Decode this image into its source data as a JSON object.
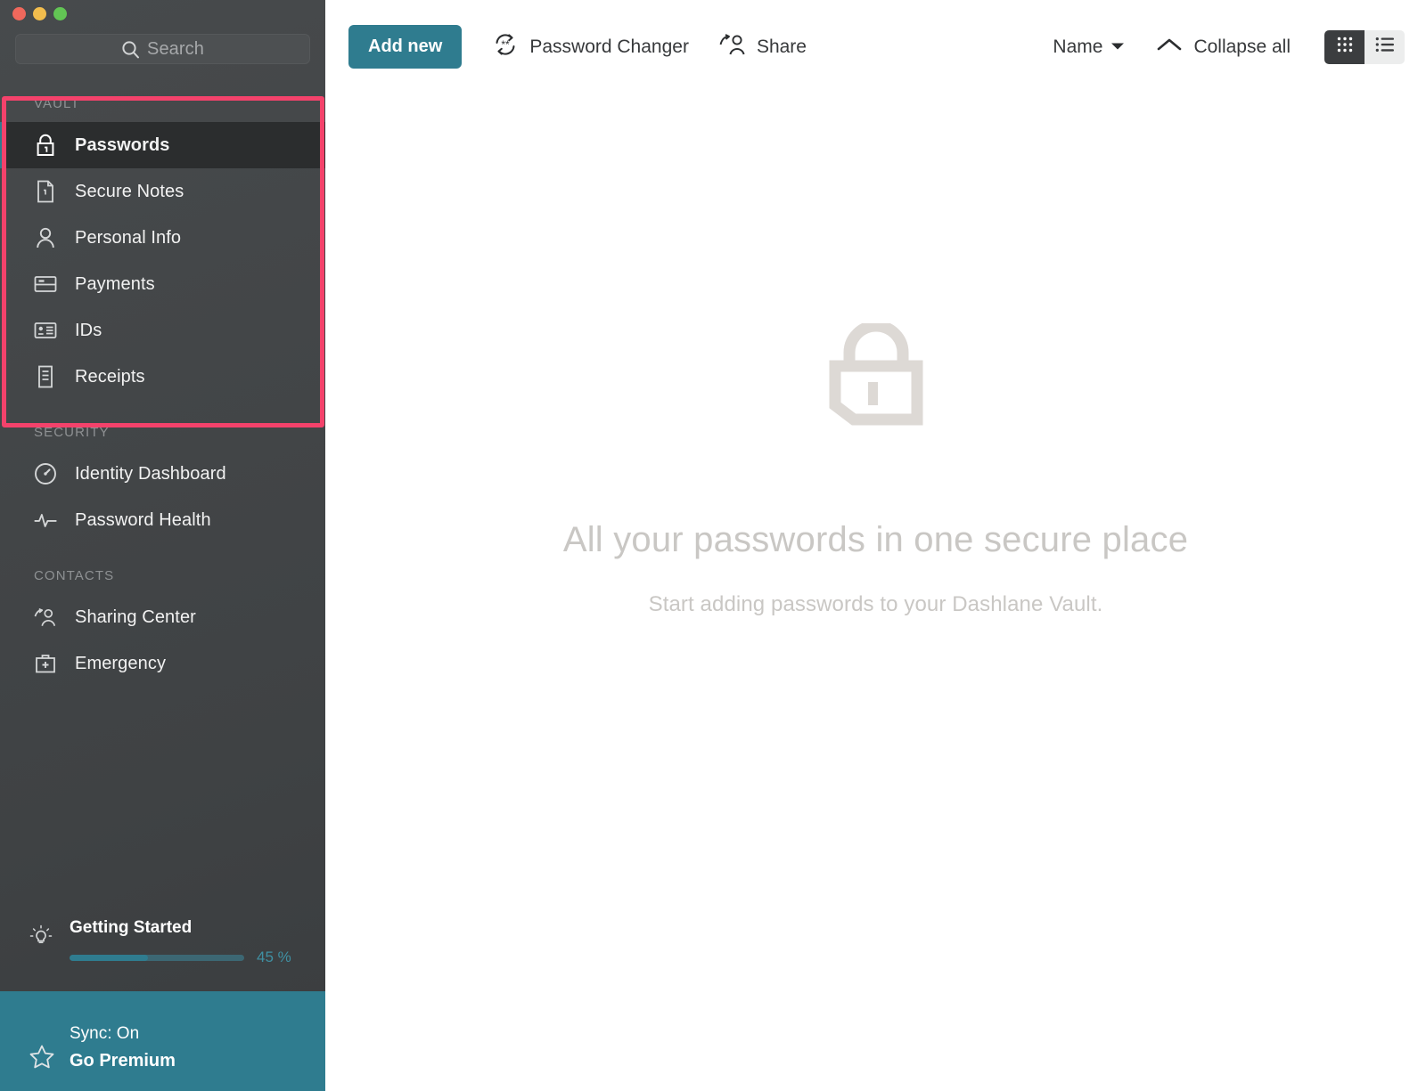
{
  "window": {
    "traffic_lights": [
      "close",
      "minimize",
      "maximize"
    ]
  },
  "sidebar": {
    "search": {
      "placeholder": "Search",
      "value": ""
    },
    "sections": [
      {
        "id": "vault",
        "label": "VAULT",
        "items": [
          {
            "label": "Passwords",
            "icon": "lock-icon",
            "selected": true
          },
          {
            "label": "Secure Notes",
            "icon": "secure-note-icon",
            "selected": false
          },
          {
            "label": "Personal Info",
            "icon": "person-icon",
            "selected": false
          },
          {
            "label": "Payments",
            "icon": "credit-card-icon",
            "selected": false
          },
          {
            "label": "IDs",
            "icon": "id-card-icon",
            "selected": false
          },
          {
            "label": "Receipts",
            "icon": "receipt-icon",
            "selected": false
          }
        ]
      },
      {
        "id": "security",
        "label": "SECURITY",
        "items": [
          {
            "label": "Identity Dashboard",
            "icon": "gauge-icon",
            "selected": false
          },
          {
            "label": "Password Health",
            "icon": "pulse-icon",
            "selected": false
          }
        ]
      },
      {
        "id": "contacts",
        "label": "CONTACTS",
        "items": [
          {
            "label": "Sharing Center",
            "icon": "share-person-icon",
            "selected": false
          },
          {
            "label": "Emergency",
            "icon": "first-aid-kit-icon",
            "selected": false
          }
        ]
      }
    ],
    "getting_started": {
      "title": "Getting Started",
      "icon": "lightbulb-icon",
      "progress_percent": 45,
      "progress_label": "45 %"
    },
    "footer": {
      "sync_status": "Sync: On",
      "premium_label": "Go Premium",
      "icon": "star-icon"
    }
  },
  "toolbar": {
    "add_new_label": "Add new",
    "password_changer_label": "Password Changer",
    "password_changer_icon": "password-changer-icon",
    "share_label": "Share",
    "share_icon": "share-icon",
    "sort_label": "Name",
    "sort_icon": "chevron-down-icon",
    "collapse_label": "Collapse all",
    "collapse_icon": "chevron-up-icon",
    "view_grid_icon": "grid-view-icon",
    "view_list_icon": "list-view-icon",
    "active_view": "grid"
  },
  "main": {
    "empty_state": {
      "icon": "big-lock-icon",
      "title": "All your passwords in one secure place",
      "subtitle": "Start adding passwords to your Dashlane Vault."
    }
  },
  "colors": {
    "accent_teal": "#2f7c8f",
    "highlight_pink": "#f4426b",
    "sidebar_bg": "#434648",
    "selected_row": "#2b2d2e",
    "empty_text": "#c9c7c4"
  }
}
